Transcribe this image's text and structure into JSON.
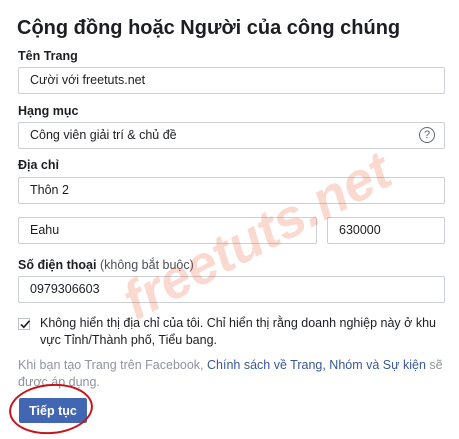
{
  "page": {
    "title": "Cộng đồng hoặc Người của công chúng"
  },
  "form": {
    "page_name": {
      "label": "Tên Trang",
      "value": "Cười với freetuts.net"
    },
    "category": {
      "label": "Hạng mục",
      "value": "Công viên giải trí & chủ đề",
      "help_icon": "?"
    },
    "address": {
      "label": "Địa chỉ",
      "street": "Thôn 2",
      "city": "Eahu",
      "postal_code": "630000"
    },
    "phone": {
      "label": "Số điện thoại",
      "optional": "(không bắt buộc)",
      "value": "0979306603"
    },
    "hide_address": {
      "checked": true,
      "text": "Không hiển thị địa chỉ của tôi. Chỉ hiển thị rằng doanh nghiệp này ở khu vực Tỉnh/Thành phố, Tiểu bang."
    },
    "terms": {
      "prefix": "Khi bạn tạo Trang trên Facebook, ",
      "link": "Chính sách về Trang, Nhóm và Sự kiện",
      "suffix": " sẽ được áp dụng."
    },
    "submit_label": "Tiếp tục"
  },
  "watermark": "freetuts.net",
  "colors": {
    "primary_button": "#4267b2",
    "link": "#385898",
    "annotation_circle": "#c4151c"
  }
}
